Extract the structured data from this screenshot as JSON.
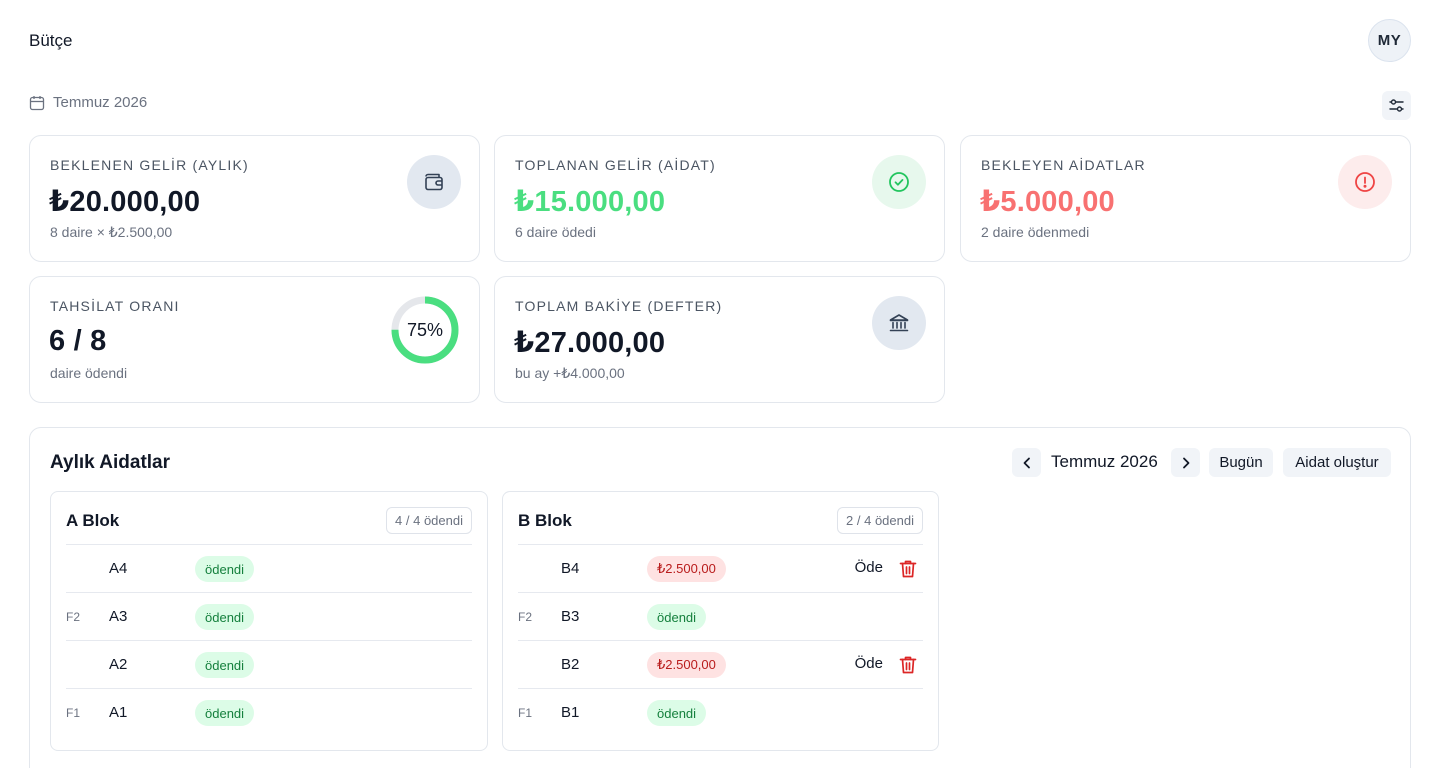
{
  "app": {
    "title": "Bütçe",
    "avatar_initials": "MY"
  },
  "period": {
    "label": "Temmuz 2026"
  },
  "cards": {
    "expected": {
      "label": "BEKLENEN GELİR (AYLIK)",
      "value": "₺20.000,00",
      "sub": "8 daire × ₺2.500,00",
      "icon": "wallet-icon"
    },
    "collected": {
      "label": "TOPLANAN GELİR (AİDAT)",
      "value": "₺15.000,00",
      "sub": "6 daire ödedi",
      "icon": "check-circle-icon"
    },
    "pending": {
      "label": "BEKLEYEN AİDATLAR",
      "value": "₺5.000,00",
      "sub": "2 daire ödenmedi",
      "icon": "alert-circle-icon"
    },
    "rate": {
      "label": "TAHSİLAT ORANI",
      "value": "6 / 8",
      "sub": "daire ödendi",
      "percent_text": "75%",
      "percent": 75
    },
    "balance": {
      "label": "TOPLAM BAKİYE (DEFTER)",
      "value": "₺27.000,00",
      "sub": "bu ay +₺4.000,00",
      "icon": "bank-icon"
    }
  },
  "colors": {
    "green": "#4ade80",
    "red": "#f87171",
    "ring_track": "#e5e7eb"
  },
  "dues": {
    "title": "Aylık Aidatlar",
    "month": "Temmuz 2026",
    "today_label": "Bugün",
    "create_label": "Aidat oluştur",
    "blocks": [
      {
        "title": "A Blok",
        "count": "4 / 4 ödendi",
        "rows": [
          {
            "floor": "",
            "unit": "A4",
            "status": "ödendi",
            "paid": true
          },
          {
            "floor": "F2",
            "unit": "A3",
            "status": "ödendi",
            "paid": true
          },
          {
            "floor": "",
            "unit": "A2",
            "status": "ödendi",
            "paid": true
          },
          {
            "floor": "F1",
            "unit": "A1",
            "status": "ödendi",
            "paid": true
          }
        ]
      },
      {
        "title": "B Blok",
        "count": "2 / 4 ödendi",
        "rows": [
          {
            "floor": "",
            "unit": "B4",
            "status": "₺2.500,00",
            "paid": false,
            "action": "Öde"
          },
          {
            "floor": "F2",
            "unit": "B3",
            "status": "ödendi",
            "paid": true
          },
          {
            "floor": "",
            "unit": "B2",
            "status": "₺2.500,00",
            "paid": false,
            "action": "Öde"
          },
          {
            "floor": "F1",
            "unit": "B1",
            "status": "ödendi",
            "paid": true
          }
        ]
      }
    ]
  }
}
